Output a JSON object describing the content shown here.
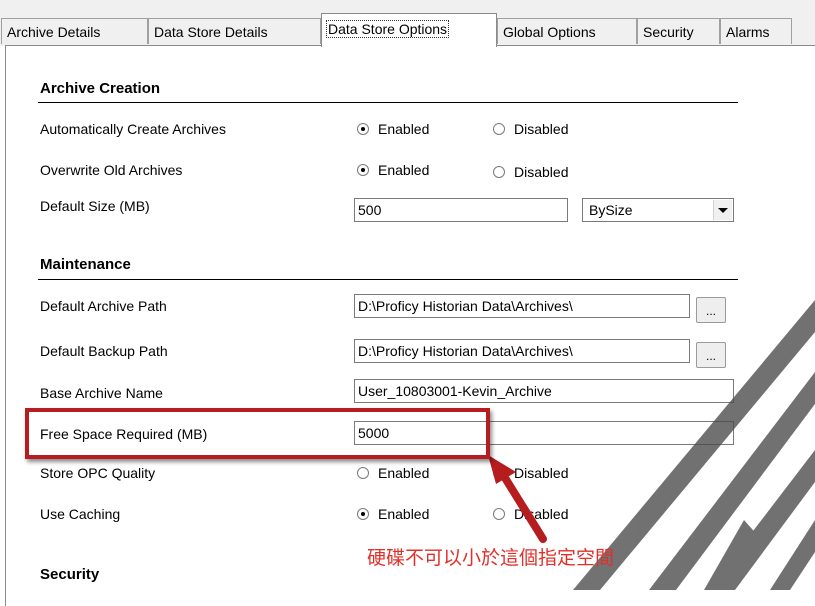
{
  "tabs": [
    {
      "label": "Archive Details"
    },
    {
      "label": "Data Store Details"
    },
    {
      "label": "Data Store Options"
    },
    {
      "label": "Global Options"
    },
    {
      "label": "Security"
    },
    {
      "label": "Alarms"
    }
  ],
  "active_tab": "Data Store Options",
  "archive_creation": {
    "title": "Archive Creation",
    "auto_create": {
      "label": "Automatically Create Archives",
      "enabled": "Enabled",
      "disabled": "Disabled",
      "selected": "Enabled"
    },
    "overwrite": {
      "label": "Overwrite Old Archives",
      "enabled": "Enabled",
      "disabled": "Disabled",
      "selected": "Enabled"
    },
    "default_size": {
      "label": "Default Size (MB)",
      "value": "500",
      "mode": "BySize"
    }
  },
  "maintenance": {
    "title": "Maintenance",
    "archive_path": {
      "label": "Default Archive Path",
      "value": "D:\\Proficy Historian Data\\Archives\\",
      "browse": "..."
    },
    "backup_path": {
      "label": "Default Backup Path",
      "value": "D:\\Proficy Historian Data\\Archives\\",
      "browse": "..."
    },
    "base_name": {
      "label": "Base Archive Name",
      "value": "User_10803001-Kevin_Archive"
    },
    "free_space": {
      "label": "Free Space Required (MB)",
      "value": "5000"
    },
    "opc_quality": {
      "label": "Store OPC Quality",
      "enabled": "Enabled",
      "disabled": "Disabled",
      "selected": "Disabled"
    },
    "caching": {
      "label": "Use Caching",
      "enabled": "Enabled",
      "disabled": "Disabled",
      "selected": "Enabled"
    }
  },
  "security": {
    "title": "Security"
  },
  "annotation": {
    "text": "硬碟不可以小於這個指定空間",
    "color": "#e0302a",
    "highlight_color": "#b51d1f"
  }
}
